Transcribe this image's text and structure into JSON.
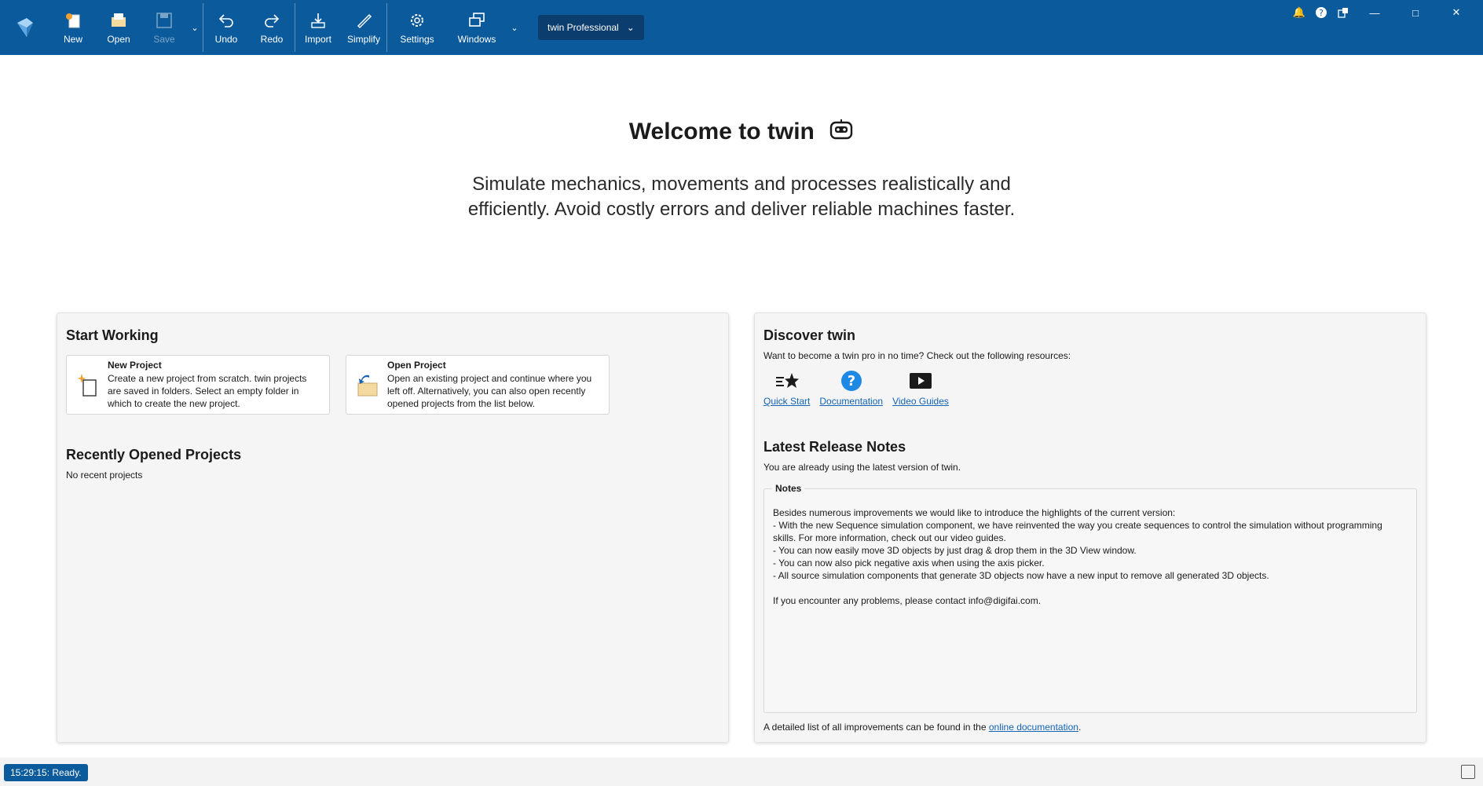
{
  "toolbar": {
    "buttons": {
      "new": "New",
      "open": "Open",
      "save": "Save",
      "undo": "Undo",
      "redo": "Redo",
      "import": "Import",
      "simplify": "Simplify",
      "settings": "Settings",
      "windows": "Windows"
    },
    "edition": "twin Professional",
    "icons": [
      "app-logo-icon",
      "new-file-icon",
      "open-folder-icon",
      "save-icon",
      "undo-icon",
      "redo-icon",
      "import-icon",
      "simplify-icon",
      "gear-icon",
      "windows-icon",
      "bell-icon",
      "help-icon",
      "switch-icon",
      "minimize-icon",
      "maximize-icon",
      "close-icon"
    ]
  },
  "hero": {
    "title": "Welcome to twin",
    "subtitle_line1": "Simulate mechanics, movements and processes realistically and",
    "subtitle_line2": "efficiently. Avoid costly errors and deliver reliable machines faster."
  },
  "start_working": {
    "heading": "Start Working",
    "new_project": {
      "title": "New Project",
      "description": "Create a new project from scratch. twin projects are saved in folders. Select an empty folder in which to create the new project."
    },
    "open_project": {
      "title": "Open Project",
      "description": "Open an existing project and continue where you left off. Alternatively, you can also open recently opened projects from the list below."
    }
  },
  "recent": {
    "heading": "Recently Opened Projects",
    "empty_text": "No recent projects"
  },
  "discover": {
    "heading": "Discover twin",
    "intro": "Want to become a twin pro in no time? Check out the following resources:",
    "resources": [
      "Quick Start",
      "Documentation",
      "Video Guides"
    ]
  },
  "release_notes": {
    "heading": "Latest Release Notes",
    "status": "You are already using the latest version of twin.",
    "notes_legend": "Notes",
    "lines": [
      "Besides numerous improvements we would like to introduce the highlights of the current version:",
      "- With the new Sequence simulation component, we have reinvented the way you create sequences to control the simulation without programming skills. For more information, check out our video guides.",
      "- You can now easily move 3D objects by just drag & drop them in the 3D View window.",
      "- You can now also pick negative axis when using the axis picker.",
      "- All source simulation components that generate 3D objects now have a new input to remove all generated 3D objects.",
      "",
      "If you encounter any problems, please contact info@digifai.com."
    ],
    "footer_prefix": "A detailed list of all improvements can be found in the ",
    "footer_link": "online documentation",
    "footer_suffix": "."
  },
  "status_bar": {
    "message": "15:29:15: Ready."
  },
  "colors": {
    "toolbar_bg": "#0a5a9c",
    "edition_bg": "#0b3d6e",
    "link": "#1463b5",
    "panel_bg": "#f5f5f5"
  }
}
